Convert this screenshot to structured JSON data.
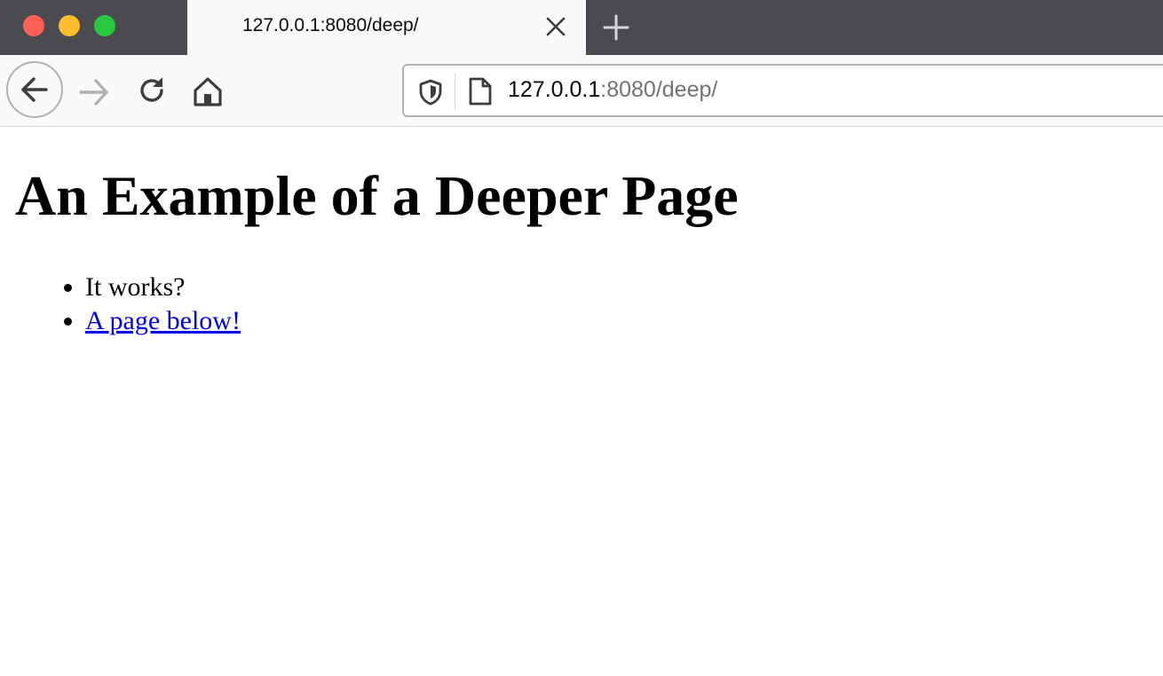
{
  "window": {
    "traffic_lights": {
      "close_color": "#ff5f57",
      "minimize_color": "#febc2e",
      "zoom_color": "#28c840"
    }
  },
  "tab": {
    "title": "127.0.0.1:8080/deep/",
    "close_icon": "close-icon"
  },
  "new_tab_icon": "plus-icon",
  "toolbar": {
    "back_icon": "arrow-left-icon",
    "forward_icon": "arrow-right-icon",
    "forward_disabled": true,
    "reload_icon": "reload-icon",
    "home_icon": "home-icon"
  },
  "urlbar": {
    "shield_icon": "shield-icon",
    "page_icon": "page-icon",
    "host": "127.0.0.1",
    "rest": ":8080/deep/"
  },
  "page": {
    "heading": "An Example of a Deeper Page",
    "items": [
      {
        "text": "It works?",
        "is_link": false
      },
      {
        "text": "A page below!",
        "is_link": true
      }
    ],
    "link_color": "#0000ee"
  }
}
